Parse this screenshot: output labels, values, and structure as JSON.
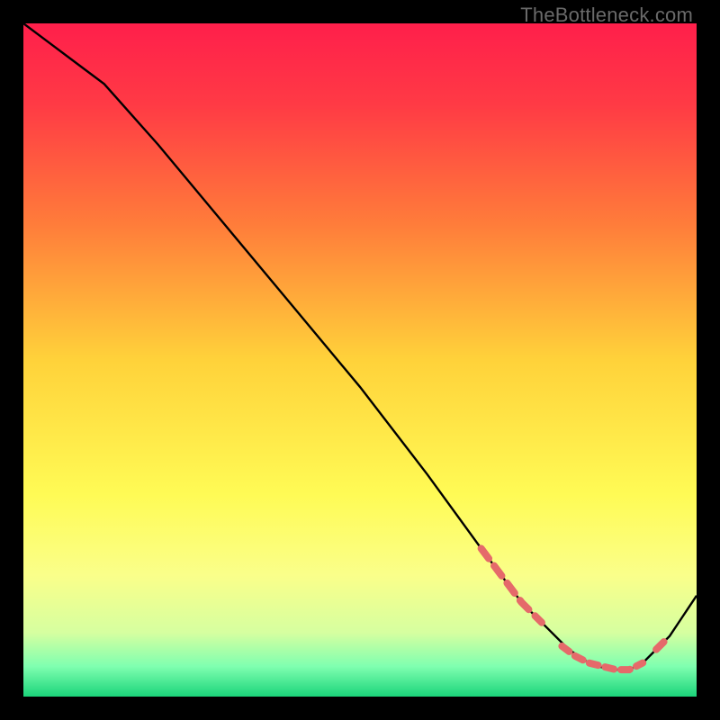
{
  "watermark": "TheBottleneck.com",
  "chart_data": {
    "type": "line",
    "title": "",
    "xlabel": "",
    "ylabel": "",
    "xlim": [
      0,
      100
    ],
    "ylim": [
      0,
      100
    ],
    "background_gradient": {
      "stops": [
        {
          "pos": 0.0,
          "color": "#ff1f4b"
        },
        {
          "pos": 0.12,
          "color": "#ff3a45"
        },
        {
          "pos": 0.3,
          "color": "#ff7d3a"
        },
        {
          "pos": 0.5,
          "color": "#ffd23a"
        },
        {
          "pos": 0.7,
          "color": "#fffb55"
        },
        {
          "pos": 0.82,
          "color": "#faff8a"
        },
        {
          "pos": 0.905,
          "color": "#d6ffa0"
        },
        {
          "pos": 0.955,
          "color": "#7fffb0"
        },
        {
          "pos": 1.0,
          "color": "#1bd47a"
        }
      ]
    },
    "series": [
      {
        "name": "curve",
        "color": "#000000",
        "x": [
          0,
          4,
          8,
          12,
          20,
          30,
          40,
          50,
          60,
          68,
          74,
          78,
          81,
          84,
          87,
          90,
          92,
          94,
          96,
          98,
          100
        ],
        "y": [
          100,
          97,
          94,
          91,
          82,
          70,
          58,
          46,
          33,
          22,
          14,
          10,
          7,
          5,
          4,
          4,
          5,
          7,
          9,
          12,
          15
        ]
      }
    ],
    "highlight_segments": [
      {
        "name": "descending-highlight",
        "color": "#e56a6a",
        "dash": [
          14,
          10
        ],
        "x": [
          68,
          71,
          74,
          77
        ],
        "y": [
          22,
          18,
          14,
          11
        ]
      },
      {
        "name": "valley-highlight",
        "color": "#e56a6a",
        "dash": [
          10,
          8
        ],
        "x": [
          80,
          82,
          84,
          86,
          88,
          90,
          92
        ],
        "y": [
          7.5,
          6,
          5,
          4.5,
          4,
          4,
          5
        ]
      },
      {
        "name": "ascending-highlight",
        "color": "#e56a6a",
        "dash": [
          12,
          20
        ],
        "x": [
          94,
          96
        ],
        "y": [
          7,
          9
        ]
      }
    ]
  }
}
